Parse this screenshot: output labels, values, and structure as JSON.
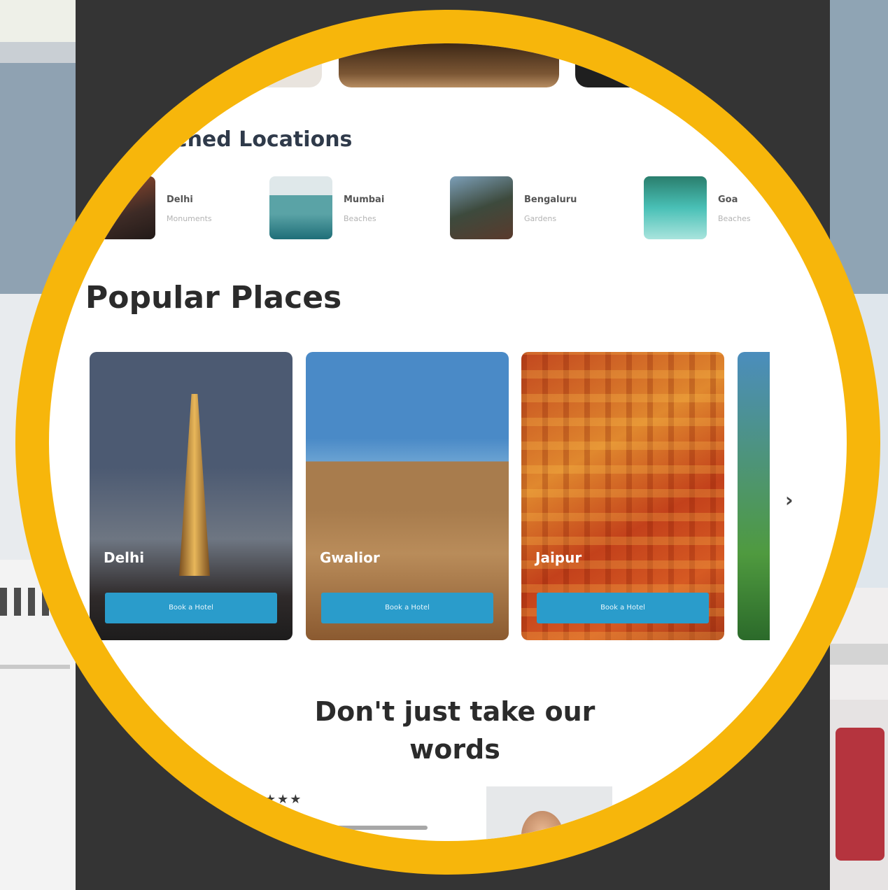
{
  "searched_locations": {
    "title": "Searched Locations",
    "title_visible": "rched Locations",
    "items": [
      {
        "name": "Delhi",
        "subtitle": "Monuments"
      },
      {
        "name": "Mumbai",
        "subtitle": "Beaches"
      },
      {
        "name": "Bengaluru",
        "subtitle": "Gardens"
      },
      {
        "name": "Goa",
        "subtitle": "Beaches"
      }
    ]
  },
  "popular_places": {
    "title": "Popular Places",
    "cards": [
      {
        "name": "Delhi",
        "button": "Book a Hotel"
      },
      {
        "name": "Gwalior",
        "button": "Book a Hotel"
      },
      {
        "name": "Jaipur",
        "button": "Book a Hotel"
      }
    ],
    "next_arrow": "›"
  },
  "testimonials": {
    "title_line1": "Don't just take our",
    "title_line2": "words",
    "stars": "★★★"
  },
  "colors": {
    "ring": "#f7b60b",
    "button": "#2a9ccb",
    "dark_bg": "#343434"
  }
}
